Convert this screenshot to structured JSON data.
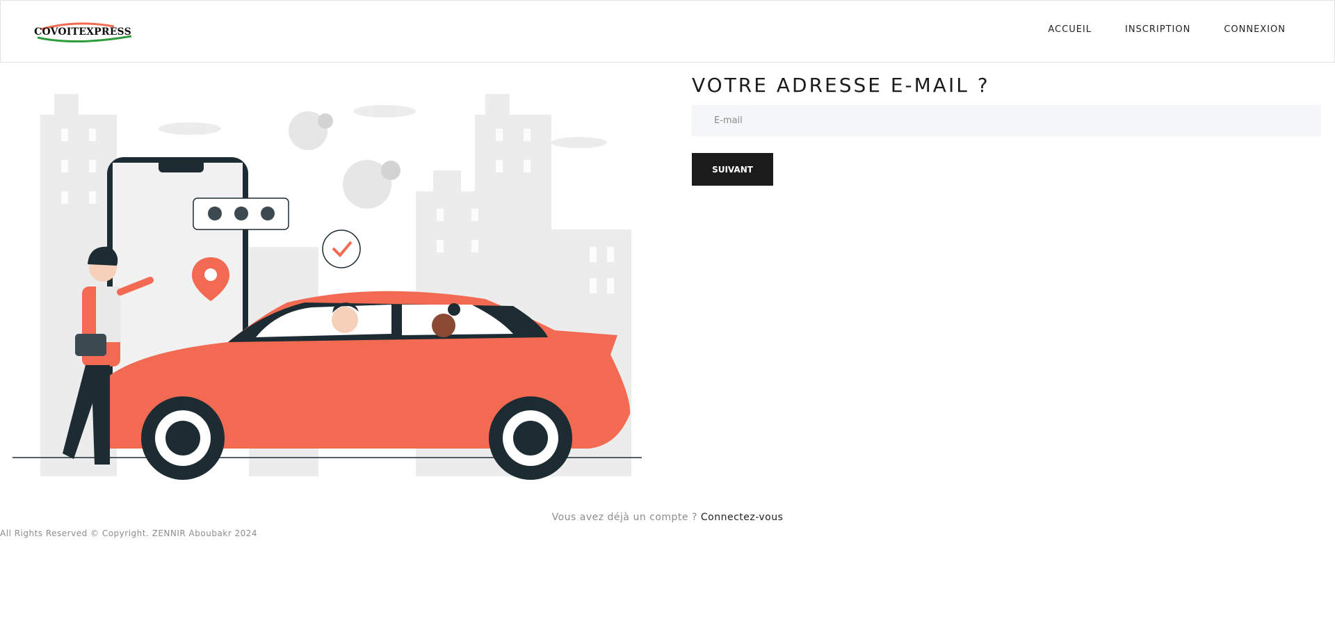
{
  "brand": {
    "logo_text": "COVOITEXPRESS"
  },
  "nav": {
    "items": [
      {
        "label": "ACCUEIL"
      },
      {
        "label": "INSCRIPTION"
      },
      {
        "label": "CONNEXION"
      }
    ]
  },
  "form": {
    "title": "VOTRE ADRESSE E-MAIL ?",
    "email_placeholder": "E-mail",
    "email_value": "",
    "next_label": "SUIVANT"
  },
  "footer": {
    "login_prompt": "Vous avez déjà un compte ?",
    "login_link": "Connectez-vous",
    "copyright": "All Rights Reserved © Copyright. ZENNIR Aboubakr 2024"
  },
  "colors": {
    "accent": "#f26a51",
    "dark": "#1b1b1b",
    "input_bg": "#f5f6f7",
    "muted_text": "#8c8c8c"
  }
}
